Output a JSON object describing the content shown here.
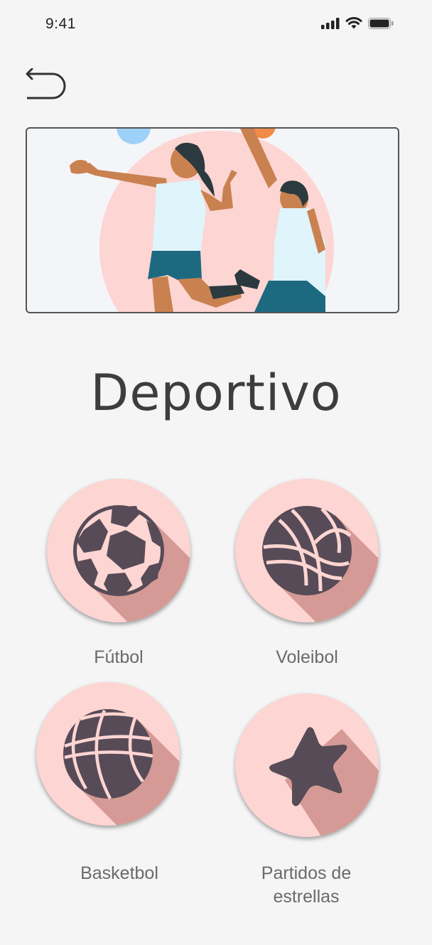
{
  "status_bar": {
    "time": "9:41"
  },
  "page": {
    "title": "Deportivo"
  },
  "sports": [
    {
      "id": "futbol",
      "label": "Fútbol",
      "icon": "soccer-ball-icon"
    },
    {
      "id": "voleibol",
      "label": "Voleibol",
      "icon": "volleyball-icon"
    },
    {
      "id": "basketbol",
      "label": "Basketbol",
      "icon": "basketball-icon"
    },
    {
      "id": "estrellas",
      "label": "Partidos de estrellas",
      "icon": "star-icon"
    }
  ],
  "colors": {
    "background": "#f5f5f5",
    "tile": "#fdd5d2",
    "tile_shadow": "#d59a95",
    "icon": "#574b57",
    "title_text": "#3d3d3d",
    "label_text": "#6a6a6a"
  }
}
